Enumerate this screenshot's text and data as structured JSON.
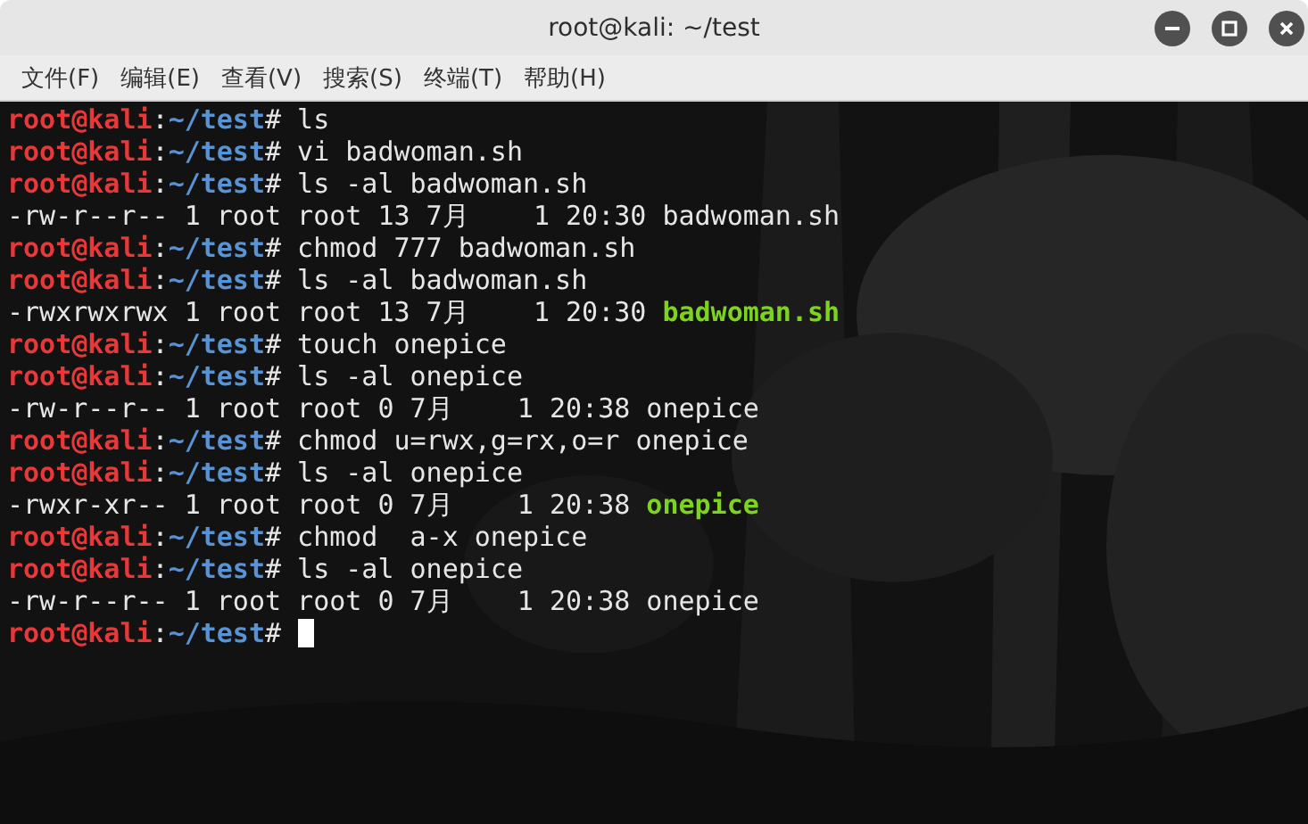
{
  "window": {
    "title": "root@kali: ~/test"
  },
  "menu": [
    "文件(F)",
    "编辑(E)",
    "查看(V)",
    "搜索(S)",
    "终端(T)",
    "帮助(H)"
  ],
  "terminal": {
    "lines": [
      {
        "kind": "prompt",
        "user_host": "root@kali",
        "sep": ":",
        "path": "~/test",
        "sign": "#",
        "command": "ls"
      },
      {
        "kind": "prompt",
        "user_host": "root@kali",
        "sep": ":",
        "path": "~/test",
        "sign": "#",
        "command": "vi badwoman.sh"
      },
      {
        "kind": "prompt",
        "user_host": "root@kali",
        "sep": ":",
        "path": "~/test",
        "sign": "#",
        "command": "ls -al badwoman.sh"
      },
      {
        "kind": "output",
        "info": "-rw-r--r-- 1 root root 13 7月    1 20:30",
        "file": "badwoman.sh",
        "executable": false
      },
      {
        "kind": "prompt",
        "user_host": "root@kali",
        "sep": ":",
        "path": "~/test",
        "sign": "#",
        "command": "chmod 777 badwoman.sh"
      },
      {
        "kind": "prompt",
        "user_host": "root@kali",
        "sep": ":",
        "path": "~/test",
        "sign": "#",
        "command": "ls -al badwoman.sh"
      },
      {
        "kind": "output",
        "info": "-rwxrwxrwx 1 root root 13 7月    1 20:30",
        "file": "badwoman.sh",
        "executable": true
      },
      {
        "kind": "prompt",
        "user_host": "root@kali",
        "sep": ":",
        "path": "~/test",
        "sign": "#",
        "command": "touch onepice"
      },
      {
        "kind": "prompt",
        "user_host": "root@kali",
        "sep": ":",
        "path": "~/test",
        "sign": "#",
        "command": "ls -al onepice"
      },
      {
        "kind": "output",
        "info": "-rw-r--r-- 1 root root 0 7月    1 20:38",
        "file": "onepice",
        "executable": false
      },
      {
        "kind": "prompt",
        "user_host": "root@kali",
        "sep": ":",
        "path": "~/test",
        "sign": "#",
        "command": "chmod u=rwx,g=rx,o=r onepice"
      },
      {
        "kind": "prompt",
        "user_host": "root@kali",
        "sep": ":",
        "path": "~/test",
        "sign": "#",
        "command": "ls -al onepice"
      },
      {
        "kind": "output",
        "info": "-rwxr-xr-- 1 root root 0 7月    1 20:38",
        "file": "onepice",
        "executable": true
      },
      {
        "kind": "prompt",
        "user_host": "root@kali",
        "sep": ":",
        "path": "~/test",
        "sign": "#",
        "command": "chmod  a-x onepice"
      },
      {
        "kind": "prompt",
        "user_host": "root@kali",
        "sep": ":",
        "path": "~/test",
        "sign": "#",
        "command": "ls -al onepice"
      },
      {
        "kind": "output",
        "info": "-rw-r--r-- 1 root root 0 7月    1 20:38",
        "file": "onepice",
        "executable": false
      },
      {
        "kind": "prompt",
        "user_host": "root@kali",
        "sep": ":",
        "path": "~/test",
        "sign": "#",
        "cursor": true
      }
    ]
  }
}
